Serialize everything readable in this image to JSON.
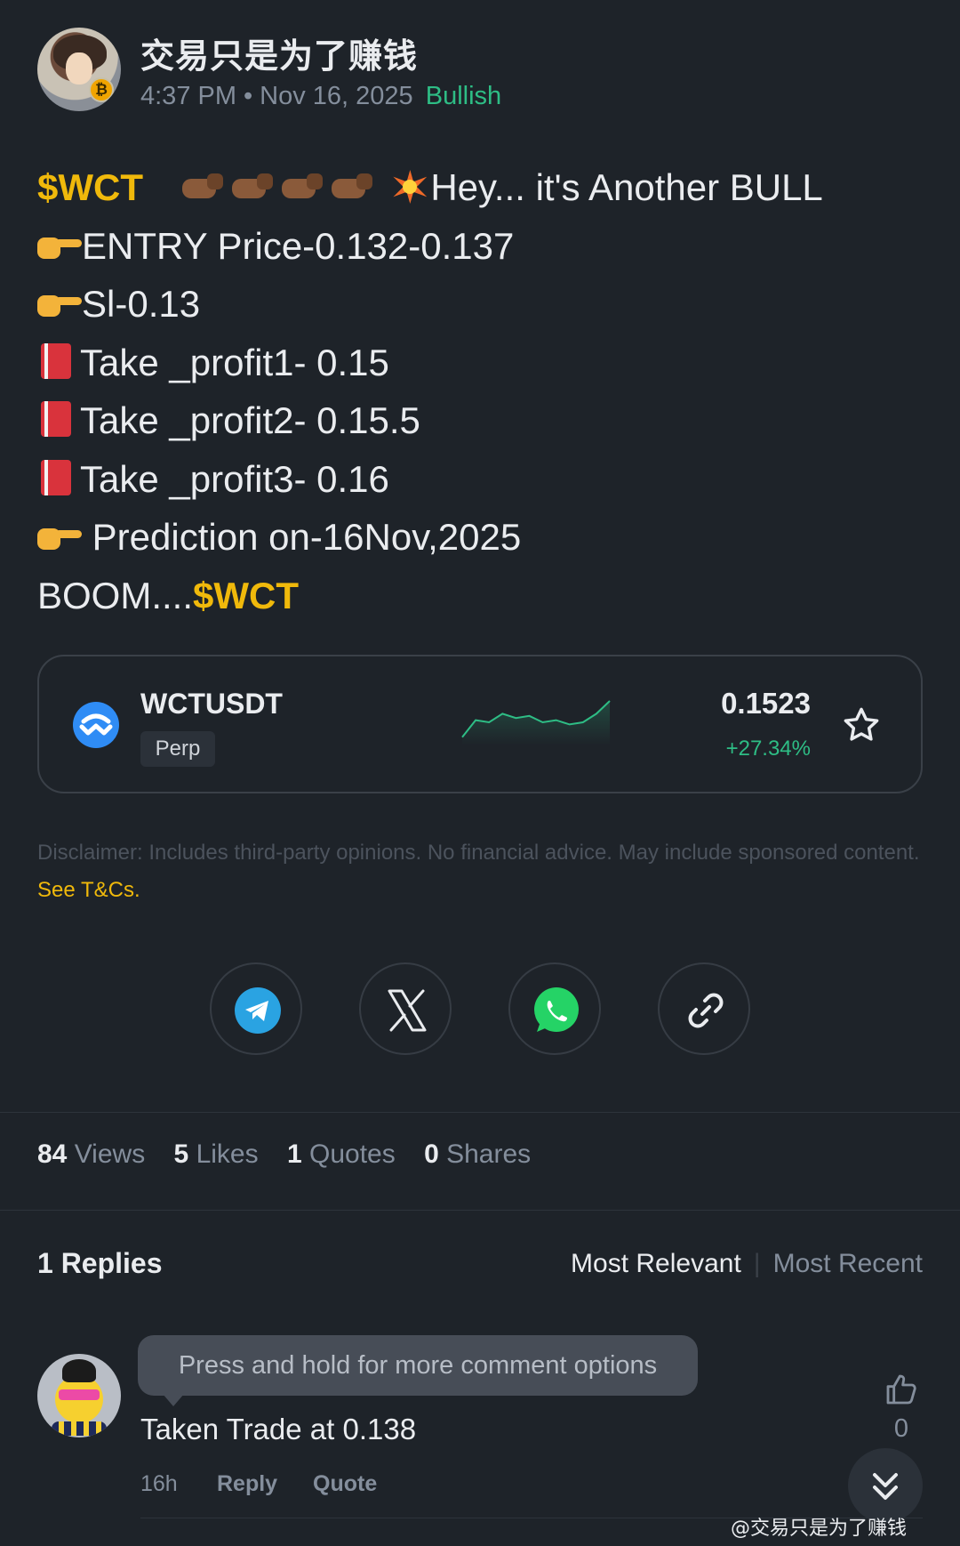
{
  "post": {
    "author": "交易只是为了赚钱",
    "time": "4:37 PM",
    "date": "Nov 16, 2025",
    "sentiment": "Bullish",
    "lines": {
      "l1_tag": "$WCT",
      "l1_text": "Hey... it's Another BULL",
      "l2": "ENTRY Price-0.132-0.137",
      "l3": "Sl-0.13",
      "l4": "Take _profit1- 0.15",
      "l5": "Take _profit2- 0.15.5",
      "l6": "Take _profit3- 0.16",
      "l7": " Prediction on-16Nov,2025",
      "l8_text": "BOOM....",
      "l8_tag": "$WCT"
    }
  },
  "ticker": {
    "pair": "WCTUSDT",
    "type": "Perp",
    "price": "0.1523",
    "change": "+27.34%",
    "sparkline_trend": [
      0.15,
      0.55,
      0.5,
      0.7,
      0.6,
      0.65,
      0.5,
      0.55,
      0.45,
      0.5,
      0.7,
      1.0
    ],
    "colors": {
      "up": "#2ebd85",
      "accent": "#f0b90b"
    }
  },
  "disclaimer": {
    "text": "Disclaimer: Includes third-party opinions. No financial advice. May include sponsored content.",
    "link": "See T&Cs."
  },
  "share": [
    "telegram-icon",
    "x-icon",
    "whatsapp-icon",
    "link-icon"
  ],
  "stats": {
    "views_n": "84",
    "views_label": "Views",
    "likes_n": "5",
    "likes_label": "Likes",
    "quotes_n": "1",
    "quotes_label": "Quotes",
    "shares_n": "0",
    "shares_label": "Shares"
  },
  "replies": {
    "count_label": "1 Replies",
    "sort_relevant": "Most Relevant",
    "sort_recent": "Most Recent"
  },
  "comment": {
    "tooltip": "Press and hold for more comment options",
    "text": "Taken Trade at 0.138",
    "age": "16h",
    "reply": "Reply",
    "quote": "Quote",
    "likes": "0"
  },
  "watermark": "@交易只是为了赚钱"
}
